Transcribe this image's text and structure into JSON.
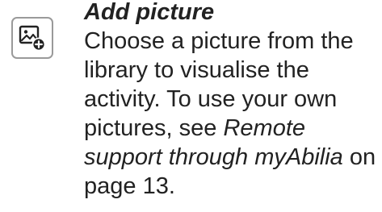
{
  "icon": {
    "name": "add-picture-icon"
  },
  "heading": "Add picture",
  "description": {
    "part1": "Choose a picture from the library to visualise the activity. To use your own pictures, see ",
    "link_text": "Remote support through myAbilia",
    "part2": " on page 13."
  }
}
